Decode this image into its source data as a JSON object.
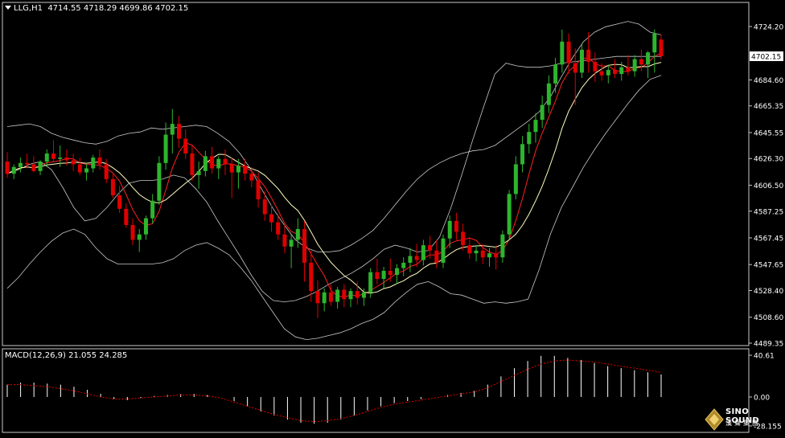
{
  "header": {
    "symbol": "LLG,H1",
    "ohlc": "4714.55 4718.29 4699.86 4702.15"
  },
  "macd": {
    "label": "MACD(12,26,9) 21.055 24.285",
    "axis_top": "40.61",
    "axis_zero": "0.00",
    "axis_bottom": "-28.155"
  },
  "price_axis": {
    "labels": [
      "4724.20",
      "4684.60",
      "4665.35",
      "4645.55",
      "4626.30",
      "4606.50",
      "4587.25",
      "4567.45",
      "4547.65",
      "4528.40",
      "4508.60",
      "4489.35"
    ],
    "current_price": "4702.15"
  },
  "logo": {
    "main": "SINO SOUND",
    "sub": "漢聲集團"
  },
  "colors": {
    "bull": "#2db52d",
    "bear": "#e00000",
    "bands": "#c8c8c8",
    "ma_fast": "#ff2020",
    "ma_slow": "#ffffc0",
    "signal": "#e00000",
    "histogram": "#ffffff"
  },
  "chart_data": {
    "type": "candlestick",
    "title": "",
    "ylim": [
      4489.35,
      4724.2
    ],
    "candles": [
      [
        4624,
        4631,
        4612,
        4615
      ],
      [
        4615,
        4622,
        4611,
        4620
      ],
      [
        4620,
        4627,
        4616,
        4623
      ],
      [
        4623,
        4630,
        4619,
        4622
      ],
      [
        4622,
        4628,
        4616,
        4617
      ],
      [
        4617,
        4625,
        4614,
        4624
      ],
      [
        4624,
        4633,
        4620,
        4630
      ],
      [
        4630,
        4640,
        4624,
        4626
      ],
      [
        4626,
        4636,
        4620,
        4627
      ],
      [
        4627,
        4633,
        4621,
        4625
      ],
      [
        4625,
        4630,
        4617,
        4622
      ],
      [
        4622,
        4627,
        4614,
        4616
      ],
      [
        4616,
        4622,
        4610,
        4619
      ],
      [
        4619,
        4629,
        4616,
        4627
      ],
      [
        4627,
        4633,
        4618,
        4622
      ],
      [
        4622,
        4626,
        4608,
        4611
      ],
      [
        4611,
        4615,
        4597,
        4599
      ],
      [
        4599,
        4606,
        4586,
        4589
      ],
      [
        4589,
        4593,
        4575,
        4577
      ],
      [
        4577,
        4582,
        4562,
        4566
      ],
      [
        4566,
        4574,
        4557,
        4570
      ],
      [
        4570,
        4584,
        4566,
        4582
      ],
      [
        4582,
        4600,
        4578,
        4595
      ],
      [
        4595,
        4628,
        4592,
        4623
      ],
      [
        4623,
        4653,
        4618,
        4644
      ],
      [
        4644,
        4663,
        4630,
        4652
      ],
      [
        4652,
        4658,
        4634,
        4641
      ],
      [
        4641,
        4648,
        4626,
        4630
      ],
      [
        4630,
        4636,
        4610,
        4614
      ],
      [
        4614,
        4624,
        4604,
        4617
      ],
      [
        4617,
        4632,
        4613,
        4628
      ],
      [
        4628,
        4635,
        4615,
        4619
      ],
      [
        4619,
        4628,
        4611,
        4626
      ],
      [
        4626,
        4633,
        4614,
        4622
      ],
      [
        4622,
        4627,
        4597,
        4616
      ],
      [
        4616,
        4626,
        4604,
        4621
      ],
      [
        4621,
        4626,
        4610,
        4615
      ],
      [
        4615,
        4620,
        4605,
        4610
      ],
      [
        4610,
        4616,
        4590,
        4596
      ],
      [
        4596,
        4602,
        4580,
        4585
      ],
      [
        4585,
        4592,
        4572,
        4579
      ],
      [
        4579,
        4585,
        4566,
        4570
      ],
      [
        4570,
        4577,
        4556,
        4561
      ],
      [
        4561,
        4570,
        4545,
        4566
      ],
      [
        4566,
        4582,
        4560,
        4574
      ],
      [
        4574,
        4580,
        4535,
        4549
      ],
      [
        4549,
        4558,
        4520,
        4528
      ],
      [
        4528,
        4536,
        4508,
        4519
      ],
      [
        4519,
        4530,
        4513,
        4527
      ],
      [
        4527,
        4533,
        4517,
        4520
      ],
      [
        4520,
        4531,
        4515,
        4529
      ],
      [
        4529,
        4533,
        4516,
        4522
      ],
      [
        4522,
        4530,
        4516,
        4528
      ],
      [
        4528,
        4535,
        4518,
        4523
      ],
      [
        4523,
        4530,
        4517,
        4527
      ],
      [
        4527,
        4545,
        4523,
        4542
      ],
      [
        4542,
        4552,
        4533,
        4537
      ],
      [
        4537,
        4546,
        4530,
        4543
      ],
      [
        4543,
        4552,
        4535,
        4540
      ],
      [
        4540,
        4548,
        4533,
        4545
      ],
      [
        4545,
        4553,
        4539,
        4549
      ],
      [
        4549,
        4560,
        4542,
        4554
      ],
      [
        4554,
        4563,
        4546,
        4551
      ],
      [
        4551,
        4566,
        4547,
        4562
      ],
      [
        4562,
        4569,
        4552,
        4558
      ],
      [
        4558,
        4566,
        4545,
        4549
      ],
      [
        4549,
        4570,
        4545,
        4567
      ],
      [
        4567,
        4584,
        4560,
        4580
      ],
      [
        4580,
        4586,
        4566,
        4572
      ],
      [
        4572,
        4578,
        4558,
        4562
      ],
      [
        4562,
        4568,
        4552,
        4556
      ],
      [
        4556,
        4562,
        4550,
        4558
      ],
      [
        4558,
        4563,
        4548,
        4553
      ],
      [
        4553,
        4560,
        4546,
        4556
      ],
      [
        4556,
        4562,
        4544,
        4553
      ],
      [
        4553,
        4573,
        4549,
        4570
      ],
      [
        4570,
        4603,
        4566,
        4600
      ],
      [
        4600,
        4628,
        4596,
        4622
      ],
      [
        4622,
        4643,
        4616,
        4637
      ],
      [
        4637,
        4652,
        4630,
        4646
      ],
      [
        4646,
        4660,
        4638,
        4655
      ],
      [
        4655,
        4673,
        4649,
        4666
      ],
      [
        4666,
        4688,
        4660,
        4682
      ],
      [
        4682,
        4701,
        4675,
        4696
      ],
      [
        4696,
        4722,
        4690,
        4713
      ],
      [
        4713,
        4719,
        4689,
        4697
      ],
      [
        4697,
        4708,
        4666,
        4690
      ],
      [
        4690,
        4712,
        4686,
        4707
      ],
      [
        4707,
        4720,
        4690,
        4698
      ],
      [
        4698,
        4705,
        4683,
        4691
      ],
      [
        4691,
        4697,
        4684,
        4688
      ],
      [
        4688,
        4696,
        4682,
        4692
      ],
      [
        4692,
        4700,
        4686,
        4689
      ],
      [
        4689,
        4698,
        4684,
        4694
      ],
      [
        4694,
        4703,
        4688,
        4691
      ],
      [
        4691,
        4703,
        4687,
        4700
      ],
      [
        4700,
        4707,
        4691,
        4696
      ],
      [
        4696,
        4706,
        4686,
        4705
      ],
      [
        4705,
        4722,
        4690,
        4719
      ],
      [
        4714.55,
        4718.29,
        4699.86,
        4702.15
      ]
    ],
    "bollinger": {
      "upper": [
        4650,
        4651,
        4652,
        4650,
        4645,
        4642,
        4640,
        4638,
        4637,
        4639,
        4643,
        4645,
        4646,
        4649,
        4648,
        4649,
        4650,
        4651,
        4650,
        4645,
        4639,
        4630,
        4618,
        4603,
        4589,
        4577,
        4566,
        4560,
        4557,
        4557,
        4558,
        4562,
        4567,
        4573,
        4582,
        4592,
        4602,
        4611,
        4618,
        4623,
        4627,
        4630,
        4632,
        4633,
        4636,
        4642,
        4648,
        4654,
        4661,
        4672,
        4687,
        4701,
        4713,
        4720,
        4724,
        4726,
        4728,
        4726,
        4720,
        4718
      ],
      "lower": [
        4530,
        4538,
        4548,
        4557,
        4565,
        4571,
        4574,
        4570,
        4560,
        4552,
        4548,
        4548,
        4548,
        4548,
        4549,
        4552,
        4558,
        4562,
        4564,
        4560,
        4555,
        4546,
        4536,
        4524,
        4512,
        4500,
        4494,
        4492,
        4493,
        4495,
        4497,
        4500,
        4504,
        4507,
        4512,
        4520,
        4527,
        4533,
        4535,
        4531,
        4526,
        4525,
        4522,
        4519,
        4520,
        4519,
        4520,
        4522,
        4544,
        4570,
        4590,
        4605,
        4620,
        4633,
        4645,
        4656,
        4667,
        4677,
        4685,
        4688
      ],
      "middle": [
        4615,
        4618,
        4622,
        4624,
        4618,
        4605,
        4590,
        4580,
        4582,
        4590,
        4600,
        4608,
        4610,
        4610,
        4611,
        4614,
        4612,
        4604,
        4594,
        4580,
        4567,
        4554,
        4540,
        4528,
        4521,
        4520,
        4521,
        4524,
        4528,
        4533,
        4537,
        4541,
        4546,
        4552,
        4559,
        4562,
        4560,
        4557,
        4558,
        4568,
        4589,
        4614,
        4640,
        4665,
        4689,
        4697,
        4695,
        4694,
        4694,
        4695,
        4697,
        4698,
        4699,
        4700,
        4701,
        4702,
        4702,
        4702,
        4702,
        4702
      ]
    },
    "macd": {
      "histogram": [
        12,
        14,
        14,
        13,
        12,
        10,
        7,
        3,
        -2,
        -3,
        -1,
        1,
        2,
        3,
        3,
        2,
        0,
        -4,
        -9,
        -14,
        -18,
        -22,
        -25,
        -26,
        -25,
        -22,
        -18,
        -13,
        -9,
        -6,
        -4,
        -2,
        0,
        2,
        4,
        6,
        12,
        20,
        28,
        35,
        40,
        40,
        38,
        36,
        33,
        30,
        28,
        26,
        24,
        22
      ],
      "signal": [
        12,
        12,
        11,
        10,
        8,
        6,
        3,
        0,
        -2,
        -2,
        -1,
        0,
        1,
        2,
        2,
        1,
        -1,
        -5,
        -9,
        -13,
        -17,
        -20,
        -23,
        -24,
        -23,
        -21,
        -18,
        -14,
        -10,
        -7,
        -5,
        -3,
        -1,
        1,
        3,
        5,
        9,
        15,
        21,
        27,
        32,
        35,
        36,
        35,
        34,
        32,
        30,
        28,
        26,
        24
      ]
    },
    "axes": {
      "price_range": [
        4489.35,
        4724.2
      ],
      "macd_range": [
        -28.155,
        40.61
      ]
    }
  }
}
